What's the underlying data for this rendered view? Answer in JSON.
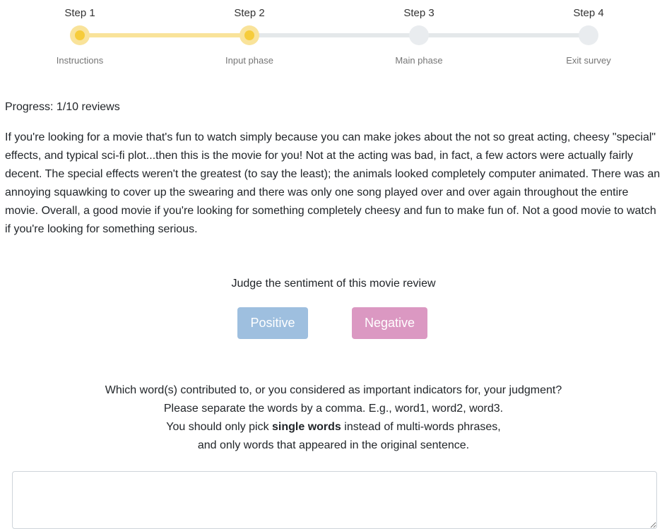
{
  "stepper": {
    "steps": [
      {
        "title": "Step 1",
        "subtitle": "Instructions",
        "state": "completed"
      },
      {
        "title": "Step 2",
        "subtitle": "Input phase",
        "state": "current"
      },
      {
        "title": "Step 3",
        "subtitle": "Main phase",
        "state": "pending"
      },
      {
        "title": "Step 4",
        "subtitle": "Exit survey",
        "state": "pending"
      }
    ],
    "colors": {
      "active": "#f6cc3b",
      "active_light": "#f9e39a",
      "inactive": "#e9ecef"
    }
  },
  "progress": {
    "text": "Progress: 1/10 reviews"
  },
  "review": {
    "text": "If you're looking for a movie that's fun to watch simply because you can make jokes about the not so great acting, cheesy \"special\" effects, and typical sci-fi plot...then this is the movie for you! Not at the acting was bad, in fact, a few actors were actually fairly decent. The special effects weren't the greatest (to say the least); the animals looked completely computer animated. There was an annoying squawking to cover up the swearing and there was only one song played over and over again throughout the entire movie. Overall, a good movie if you're looking for something completely cheesy and fun to make fun of. Not a good movie to watch if you're looking for something serious."
  },
  "judgment": {
    "prompt": "Judge the sentiment of this movie review",
    "positive_label": "Positive",
    "negative_label": "Negative",
    "positive_color": "#9ebfdf",
    "negative_color": "#db98c2"
  },
  "instructions": {
    "line1": "Which word(s) contributed to, or you considered as important indicators for, your judgment?",
    "line2": "Please separate the words by a comma. E.g., word1, word2, word3.",
    "line3_before": "You should only pick ",
    "line3_bold": "single words",
    "line3_after": " instead of multi-words phrases,",
    "line4": "and only words that appeared in the original sentence."
  },
  "answer": {
    "value": "",
    "placeholder": ""
  }
}
